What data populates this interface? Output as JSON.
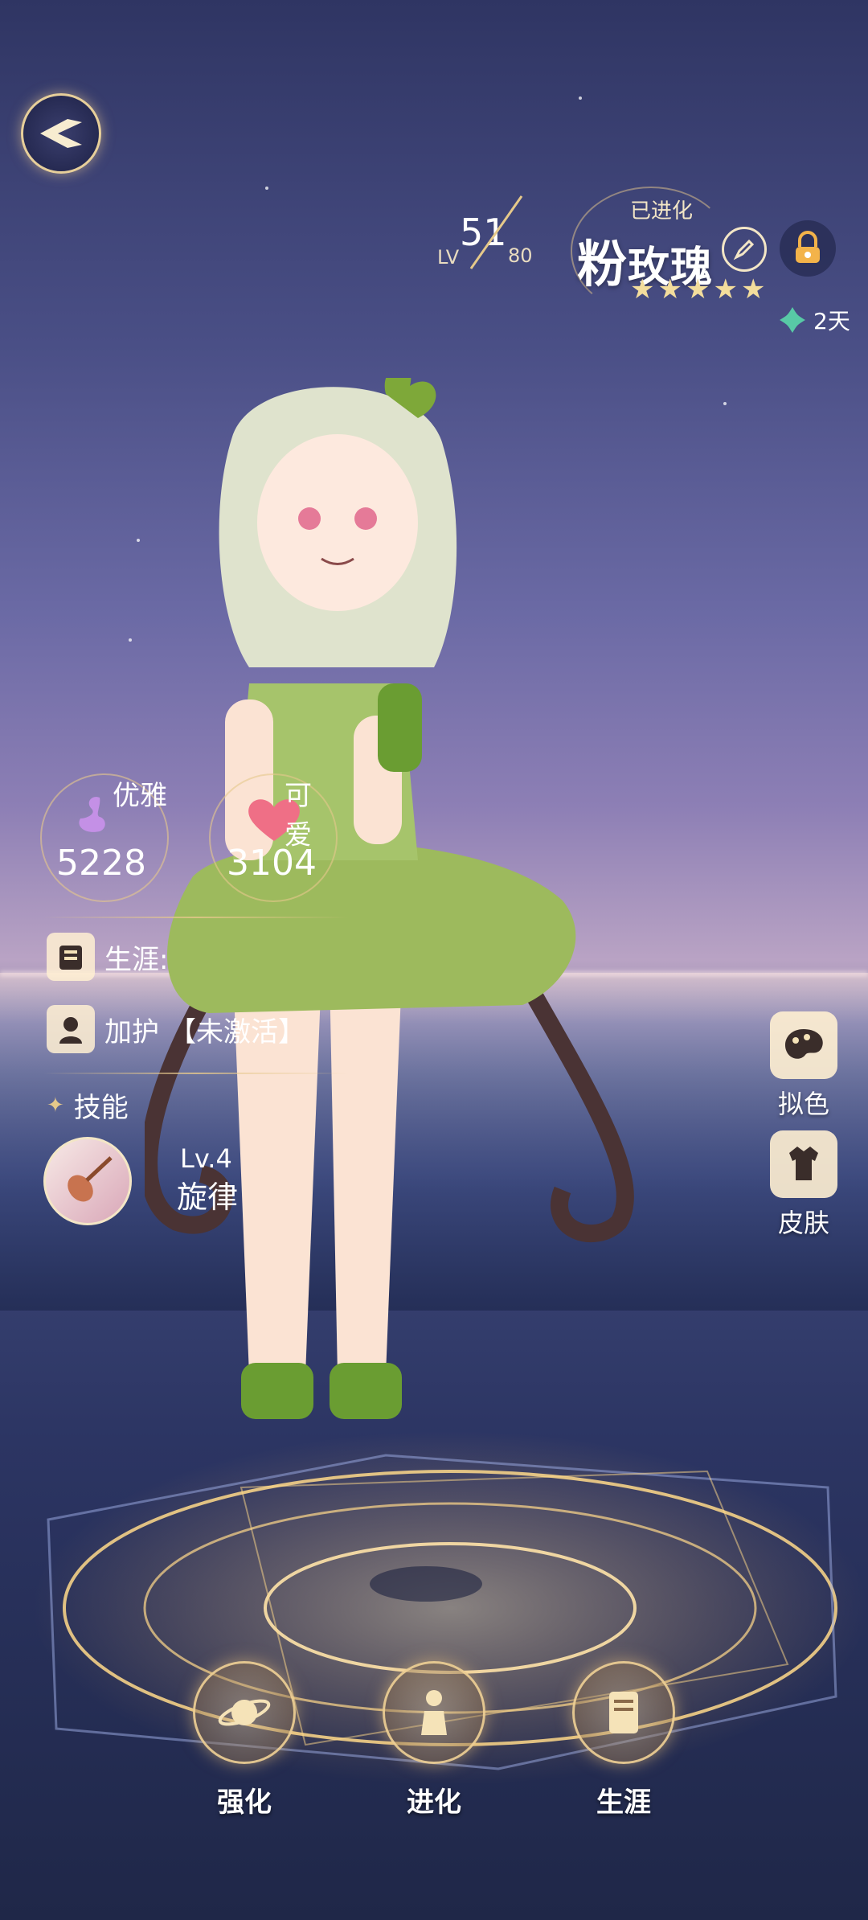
{
  "level": {
    "prefix": "LV",
    "current": "51",
    "max": "80"
  },
  "character": {
    "status": "已进化",
    "name_first": "粉",
    "name_rest": "玫瑰",
    "stars": 5,
    "timer": "2天"
  },
  "stats": [
    {
      "name": "优雅",
      "value": "5228",
      "icon": "swan-icon"
    },
    {
      "name": "可爱",
      "value": "3104",
      "icon": "heart-icon"
    }
  ],
  "career": {
    "label": "生涯:"
  },
  "protection": {
    "label": "加护",
    "value": "【未激活】"
  },
  "skills": {
    "heading": "技能",
    "level": "Lv.4",
    "name": "旋律"
  },
  "side_buttons": {
    "dye": "拟色",
    "skin": "皮肤"
  },
  "bottom_nav": {
    "enhance": "强化",
    "evolve": "进化",
    "career": "生涯"
  },
  "colors": {
    "accent_gold": "#e6c98a",
    "swan": "#c490e6",
    "heart": "#ef6f86",
    "timer_clover": "#58c9a6"
  }
}
